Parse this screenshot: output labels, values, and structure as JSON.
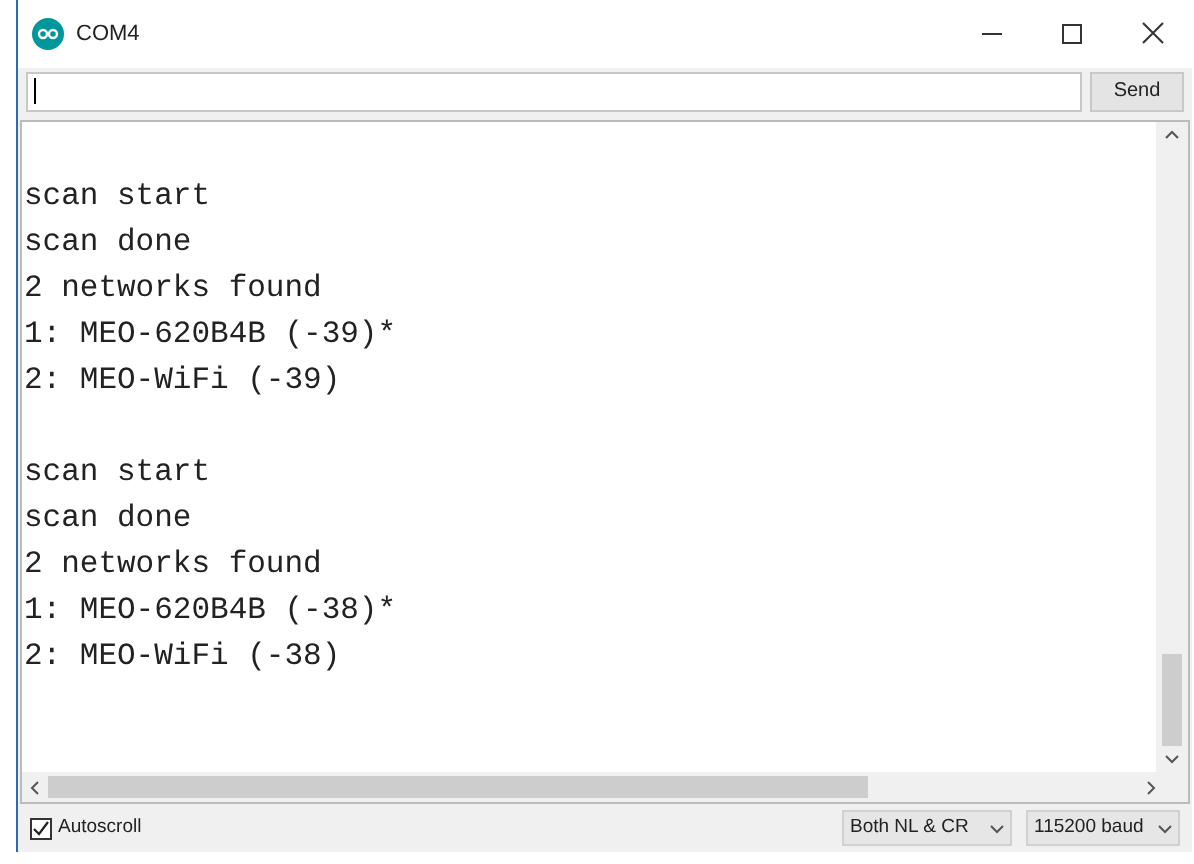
{
  "window": {
    "title": "COM4"
  },
  "send_button": "Send",
  "output_blocks": [
    [
      "scan start",
      "scan done",
      "2 networks found",
      "1: MEO-620B4B (-39)*",
      "2: MEO-WiFi (-39)"
    ],
    [
      "scan start",
      "scan done",
      "2 networks found",
      "1: MEO-620B4B (-38)*",
      "2: MEO-WiFi (-38)"
    ]
  ],
  "autoscroll": {
    "label": "Autoscroll",
    "checked": true
  },
  "line_ending": "Both NL & CR",
  "baud_rate": "115200 baud"
}
